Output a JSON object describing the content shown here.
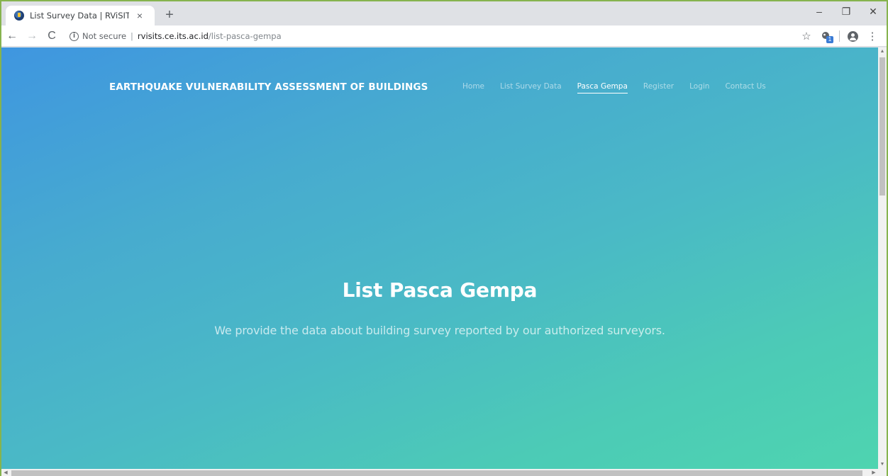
{
  "browser": {
    "tab": {
      "title": "List Survey Data | RViSITS",
      "close_glyph": "×",
      "favicon": "rvisits-favicon-icon"
    },
    "new_tab_glyph": "+",
    "window_controls": {
      "minimize": "–",
      "maximize": "❐",
      "close": "✕"
    },
    "toolbar": {
      "back": "←",
      "forward": "→",
      "reload": "C",
      "security_label": "Not secure",
      "separator": "|",
      "url_host": "rvisits.ce.its.ac.id",
      "url_path": "/list-pasca-gempa",
      "bookmark_glyph": "☆",
      "menu_glyph": "⋮",
      "extension_badge": "1"
    }
  },
  "page": {
    "brand": "EARTHQUAKE VULNERABILITY ASSESSMENT OF BUILDINGS",
    "nav": [
      {
        "label": "Home",
        "active": false
      },
      {
        "label": "List Survey Data",
        "active": false
      },
      {
        "label": "Pasca Gempa",
        "active": true
      },
      {
        "label": "Register",
        "active": false
      },
      {
        "label": "Login",
        "active": false
      },
      {
        "label": "Contact Us",
        "active": false
      }
    ],
    "hero": {
      "title": "List Pasca Gempa",
      "subtitle": "We provide the data about building survey reported by our authorized surveyors."
    }
  },
  "colors": {
    "gradient_start": "#3f96e0",
    "gradient_end": "#4ed4b0",
    "window_border": "#86b34e"
  }
}
